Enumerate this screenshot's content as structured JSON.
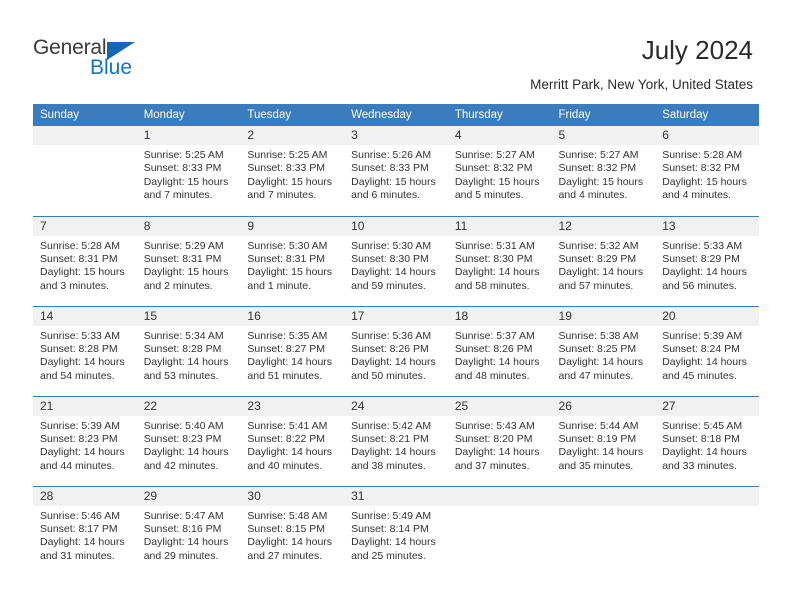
{
  "brand": {
    "name_part1": "General",
    "name_part2": "Blue",
    "accent_color": "#1572c6",
    "triangle_color": "#1268b3"
  },
  "header": {
    "title": "July 2024",
    "subtitle": "Merritt Park, New York, United States",
    "header_bg": "#3a7cbe",
    "daynum_bg": "#f1f1f1"
  },
  "weekday_headers": [
    "Sunday",
    "Monday",
    "Tuesday",
    "Wednesday",
    "Thursday",
    "Friday",
    "Saturday"
  ],
  "weeks": [
    [
      {
        "day": "",
        "sunrise": "",
        "sunset": "",
        "daylight1": "",
        "daylight2": ""
      },
      {
        "day": "1",
        "sunrise": "Sunrise: 5:25 AM",
        "sunset": "Sunset: 8:33 PM",
        "daylight1": "Daylight: 15 hours",
        "daylight2": "and 7 minutes."
      },
      {
        "day": "2",
        "sunrise": "Sunrise: 5:25 AM",
        "sunset": "Sunset: 8:33 PM",
        "daylight1": "Daylight: 15 hours",
        "daylight2": "and 7 minutes."
      },
      {
        "day": "3",
        "sunrise": "Sunrise: 5:26 AM",
        "sunset": "Sunset: 8:33 PM",
        "daylight1": "Daylight: 15 hours",
        "daylight2": "and 6 minutes."
      },
      {
        "day": "4",
        "sunrise": "Sunrise: 5:27 AM",
        "sunset": "Sunset: 8:32 PM",
        "daylight1": "Daylight: 15 hours",
        "daylight2": "and 5 minutes."
      },
      {
        "day": "5",
        "sunrise": "Sunrise: 5:27 AM",
        "sunset": "Sunset: 8:32 PM",
        "daylight1": "Daylight: 15 hours",
        "daylight2": "and 4 minutes."
      },
      {
        "day": "6",
        "sunrise": "Sunrise: 5:28 AM",
        "sunset": "Sunset: 8:32 PM",
        "daylight1": "Daylight: 15 hours",
        "daylight2": "and 4 minutes."
      }
    ],
    [
      {
        "day": "7",
        "sunrise": "Sunrise: 5:28 AM",
        "sunset": "Sunset: 8:31 PM",
        "daylight1": "Daylight: 15 hours",
        "daylight2": "and 3 minutes."
      },
      {
        "day": "8",
        "sunrise": "Sunrise: 5:29 AM",
        "sunset": "Sunset: 8:31 PM",
        "daylight1": "Daylight: 15 hours",
        "daylight2": "and 2 minutes."
      },
      {
        "day": "9",
        "sunrise": "Sunrise: 5:30 AM",
        "sunset": "Sunset: 8:31 PM",
        "daylight1": "Daylight: 15 hours",
        "daylight2": "and 1 minute."
      },
      {
        "day": "10",
        "sunrise": "Sunrise: 5:30 AM",
        "sunset": "Sunset: 8:30 PM",
        "daylight1": "Daylight: 14 hours",
        "daylight2": "and 59 minutes."
      },
      {
        "day": "11",
        "sunrise": "Sunrise: 5:31 AM",
        "sunset": "Sunset: 8:30 PM",
        "daylight1": "Daylight: 14 hours",
        "daylight2": "and 58 minutes."
      },
      {
        "day": "12",
        "sunrise": "Sunrise: 5:32 AM",
        "sunset": "Sunset: 8:29 PM",
        "daylight1": "Daylight: 14 hours",
        "daylight2": "and 57 minutes."
      },
      {
        "day": "13",
        "sunrise": "Sunrise: 5:33 AM",
        "sunset": "Sunset: 8:29 PM",
        "daylight1": "Daylight: 14 hours",
        "daylight2": "and 56 minutes."
      }
    ],
    [
      {
        "day": "14",
        "sunrise": "Sunrise: 5:33 AM",
        "sunset": "Sunset: 8:28 PM",
        "daylight1": "Daylight: 14 hours",
        "daylight2": "and 54 minutes."
      },
      {
        "day": "15",
        "sunrise": "Sunrise: 5:34 AM",
        "sunset": "Sunset: 8:28 PM",
        "daylight1": "Daylight: 14 hours",
        "daylight2": "and 53 minutes."
      },
      {
        "day": "16",
        "sunrise": "Sunrise: 5:35 AM",
        "sunset": "Sunset: 8:27 PM",
        "daylight1": "Daylight: 14 hours",
        "daylight2": "and 51 minutes."
      },
      {
        "day": "17",
        "sunrise": "Sunrise: 5:36 AM",
        "sunset": "Sunset: 8:26 PM",
        "daylight1": "Daylight: 14 hours",
        "daylight2": "and 50 minutes."
      },
      {
        "day": "18",
        "sunrise": "Sunrise: 5:37 AM",
        "sunset": "Sunset: 8:26 PM",
        "daylight1": "Daylight: 14 hours",
        "daylight2": "and 48 minutes."
      },
      {
        "day": "19",
        "sunrise": "Sunrise: 5:38 AM",
        "sunset": "Sunset: 8:25 PM",
        "daylight1": "Daylight: 14 hours",
        "daylight2": "and 47 minutes."
      },
      {
        "day": "20",
        "sunrise": "Sunrise: 5:39 AM",
        "sunset": "Sunset: 8:24 PM",
        "daylight1": "Daylight: 14 hours",
        "daylight2": "and 45 minutes."
      }
    ],
    [
      {
        "day": "21",
        "sunrise": "Sunrise: 5:39 AM",
        "sunset": "Sunset: 8:23 PM",
        "daylight1": "Daylight: 14 hours",
        "daylight2": "and 44 minutes."
      },
      {
        "day": "22",
        "sunrise": "Sunrise: 5:40 AM",
        "sunset": "Sunset: 8:23 PM",
        "daylight1": "Daylight: 14 hours",
        "daylight2": "and 42 minutes."
      },
      {
        "day": "23",
        "sunrise": "Sunrise: 5:41 AM",
        "sunset": "Sunset: 8:22 PM",
        "daylight1": "Daylight: 14 hours",
        "daylight2": "and 40 minutes."
      },
      {
        "day": "24",
        "sunrise": "Sunrise: 5:42 AM",
        "sunset": "Sunset: 8:21 PM",
        "daylight1": "Daylight: 14 hours",
        "daylight2": "and 38 minutes."
      },
      {
        "day": "25",
        "sunrise": "Sunrise: 5:43 AM",
        "sunset": "Sunset: 8:20 PM",
        "daylight1": "Daylight: 14 hours",
        "daylight2": "and 37 minutes."
      },
      {
        "day": "26",
        "sunrise": "Sunrise: 5:44 AM",
        "sunset": "Sunset: 8:19 PM",
        "daylight1": "Daylight: 14 hours",
        "daylight2": "and 35 minutes."
      },
      {
        "day": "27",
        "sunrise": "Sunrise: 5:45 AM",
        "sunset": "Sunset: 8:18 PM",
        "daylight1": "Daylight: 14 hours",
        "daylight2": "and 33 minutes."
      }
    ],
    [
      {
        "day": "28",
        "sunrise": "Sunrise: 5:46 AM",
        "sunset": "Sunset: 8:17 PM",
        "daylight1": "Daylight: 14 hours",
        "daylight2": "and 31 minutes."
      },
      {
        "day": "29",
        "sunrise": "Sunrise: 5:47 AM",
        "sunset": "Sunset: 8:16 PM",
        "daylight1": "Daylight: 14 hours",
        "daylight2": "and 29 minutes."
      },
      {
        "day": "30",
        "sunrise": "Sunrise: 5:48 AM",
        "sunset": "Sunset: 8:15 PM",
        "daylight1": "Daylight: 14 hours",
        "daylight2": "and 27 minutes."
      },
      {
        "day": "31",
        "sunrise": "Sunrise: 5:49 AM",
        "sunset": "Sunset: 8:14 PM",
        "daylight1": "Daylight: 14 hours",
        "daylight2": "and 25 minutes."
      },
      {
        "day": "",
        "sunrise": "",
        "sunset": "",
        "daylight1": "",
        "daylight2": ""
      },
      {
        "day": "",
        "sunrise": "",
        "sunset": "",
        "daylight1": "",
        "daylight2": ""
      },
      {
        "day": "",
        "sunrise": "",
        "sunset": "",
        "daylight1": "",
        "daylight2": ""
      }
    ]
  ]
}
